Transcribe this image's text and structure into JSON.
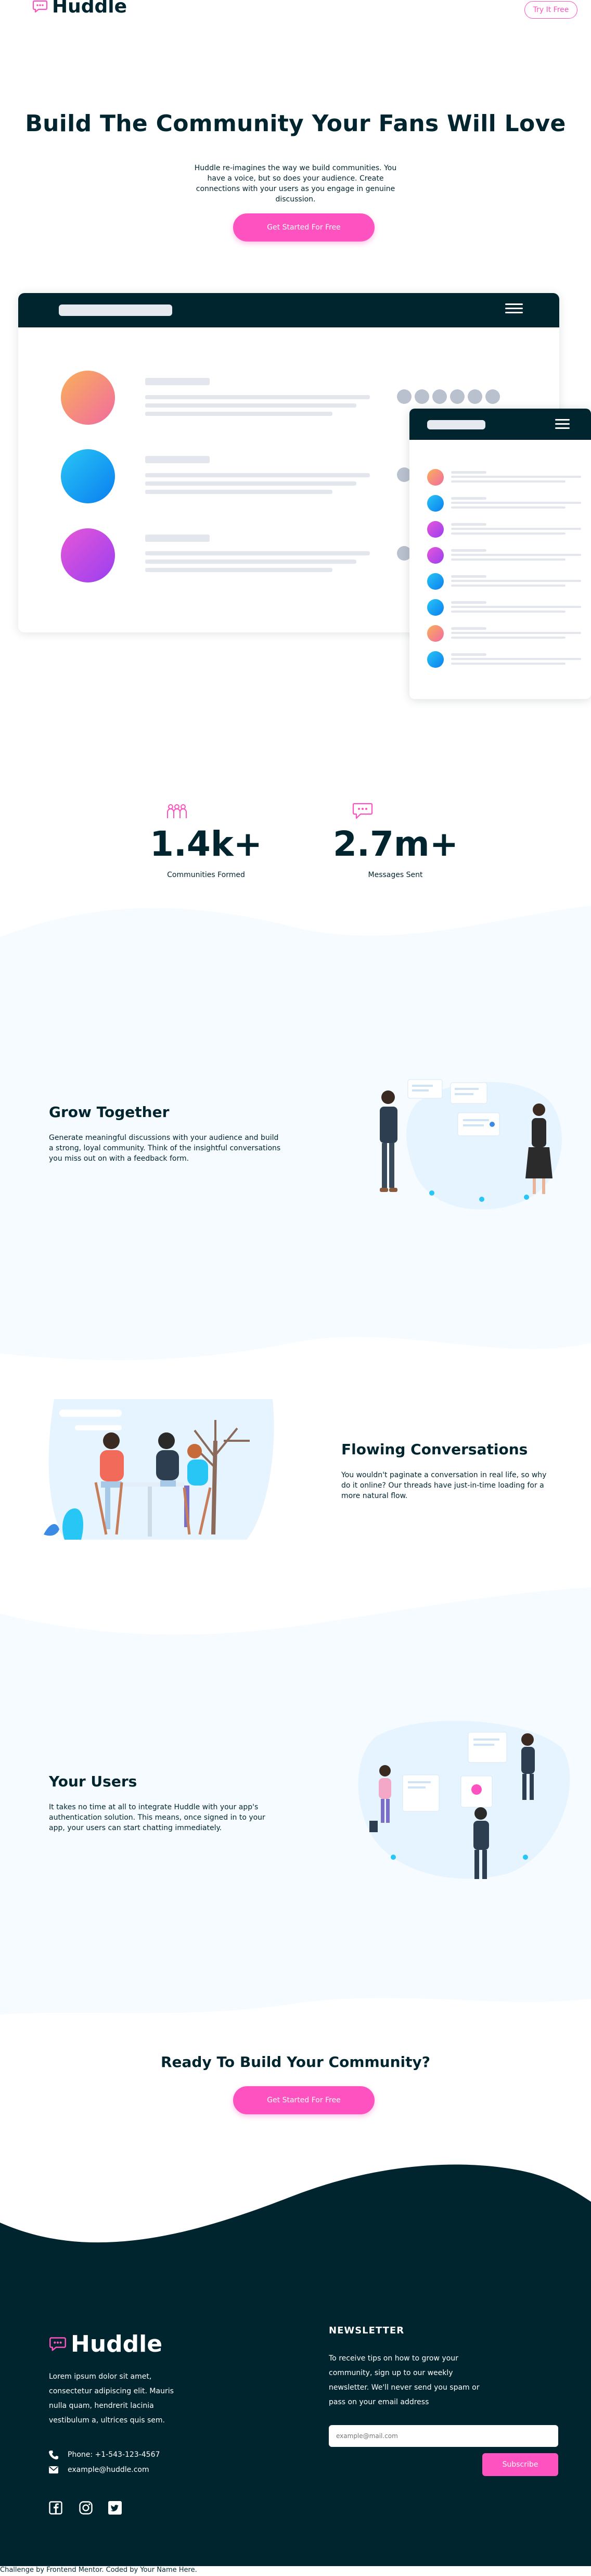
{
  "header": {
    "logo_text": "Huddle",
    "try_button": "Try It Free"
  },
  "hero": {
    "title": "Build The Community Your Fans Will Love",
    "subtitle": "Huddle re-imagines the way we build communities. You have a voice, but so does your audience. Create connections with your users as you engage in genuine discussion.",
    "cta": "Get Started For Free"
  },
  "stats": [
    {
      "icon": "communities-icon",
      "value": "1.4k+",
      "label": "Communities Formed"
    },
    {
      "icon": "messages-icon",
      "value": "2.7m+",
      "label": "Messages Sent"
    }
  ],
  "features": [
    {
      "title": "Grow Together",
      "text": "Generate meaningful discussions with your audience and build a strong, loyal community. Think of the insightful conversations you miss out on with a feedback form."
    },
    {
      "title": "Flowing Conversations",
      "text": "You wouldn't paginate a conversation in real life, so why do it online? Our threads have just-in-time loading for a more natural flow."
    },
    {
      "title": "Your Users",
      "text": "It takes no time at all to integrate Huddle with your app's authentication solution. This means, once signed in to your app, your users can start chatting immediately."
    }
  ],
  "ready": {
    "title": "Ready To Build Your Community?",
    "cta": "Get Started For Free"
  },
  "footer": {
    "logo_text": "Huddle",
    "description": "Lorem ipsum dolor sit amet, consectetur adipiscing elit. Mauris nulla quam, hendrerit lacinia vestibulum a, ultrices quis sem.",
    "phone": "Phone: +1-543-123-4567",
    "email": "example@huddle.com",
    "social_icons": [
      "facebook-icon",
      "instagram-icon",
      "twitter-icon"
    ],
    "newsletter_heading": "NEWSLETTER",
    "newsletter_text": "To receive tips on how to grow your community, sign up to our weekly newsletter. We'll never send you spam or pass on your email address",
    "email_placeholder": "example@mail.com",
    "subscribe": "Subscribe"
  },
  "credit": "Challenge by Frontend Mentor. Coded by Your Name Here.",
  "colors": {
    "pink": "#ff52c1",
    "dark": "#00252e",
    "pale_blue": "#f5fbff",
    "grey_line": "#e3e7ed"
  }
}
